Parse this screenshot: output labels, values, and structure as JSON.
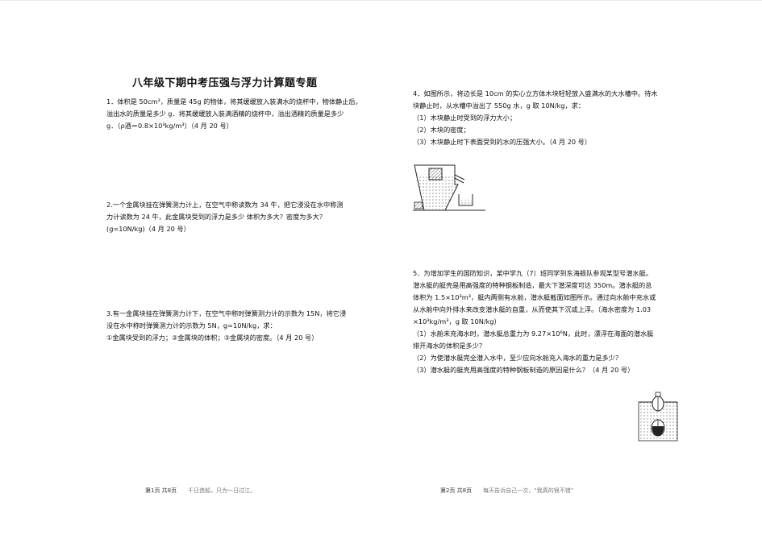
{
  "title": "八年级下期中考压强与浮力计算题专题",
  "left": {
    "q1": [
      "1．体积是 50cm³，质量是 45g 的物体，将其缓缓放入装满水的烧杯中，物体静止后，",
      "溢出水的质量是多少 g．将其缓缓放入装满酒精的烧杯中，溢出酒精的质量是多少",
      "g．（ρ酒＝0.8×10³kg/m³）（4 月 20 号）"
    ],
    "q2": [
      "2.一个金属块挂在弹簧测力计上，在空气中称读数为 34 牛，把它浸没在水中称测",
      "力计读数为 24 牛，此金属块受到的浮力是多少 体积为多大？密度为多大？",
      "(g=10N/kg)（4 月 20 号）"
    ],
    "q3": [
      "3.有一金属块挂在弹簧测力计下，在空气中称时弹簧测力计的示数为 15N，将它浸",
      "没在水中称时弹簧测力计的示数为 5N，g=10N/kg，求：",
      "①金属块受到的浮力；②金属块的体积；③金属块的密度。（4 月 20 号）"
    ]
  },
  "right": {
    "q4": [
      "4．如图所示，将边长是  10cm 的实心立方体木块轻轻放入盛满水的大水槽中。待木",
      "块静止时，从水槽中溢出了 550g 水，g 取 10N/kg，求：",
      "（1）木块静止时受到的浮力大小；",
      "（2）木块的密度；",
      "（3）木块静止时下表面受到的水的压强大小。（4 月 20 号）"
    ],
    "q5": [
      "5．为增加学生的国防知识，某中学九（7）班同学到东海舰队参观某型号潜水艇。",
      "潜水艇的艇壳是用高强度的特种钢板制造，最大下潜深度可达  350m。潜水艇的总",
      "体积为 1.5×10³m³，艇内两侧有水舱，潜水艇截面如图所示。通过向水舱中充水或",
      "从水舱中向外排水来改变潜水艇的自重，从而使其下沉或上浮。（海水密度为 1.03",
      "×10³kg/m³，g 取 10N/kg）",
      "（1）水舱未充海水时，潜水艇总重力为  9.27×10⁶N，此时，漂浮在海面的潜水艇",
      "排开海水的体积是多少？",
      "（2）为使潜水艇完全潜入水中，至少应向水舱充入海水的重力是多少？",
      "（3）潜水艇的艇壳用高强度的特种钢板制造的原因是什么？（4 月 20 号）"
    ]
  },
  "footer": {
    "left_page": "第1页 共8页",
    "left_quote": "千日造船，只为一日过江。",
    "right_page": "第2页 共8页",
    "right_quote": "每天告诉自己一次，“我真的很不错”"
  },
  "figures": {
    "fig1": "overflow-tank-with-wooden-block",
    "fig2": "submarine-cross-section"
  }
}
